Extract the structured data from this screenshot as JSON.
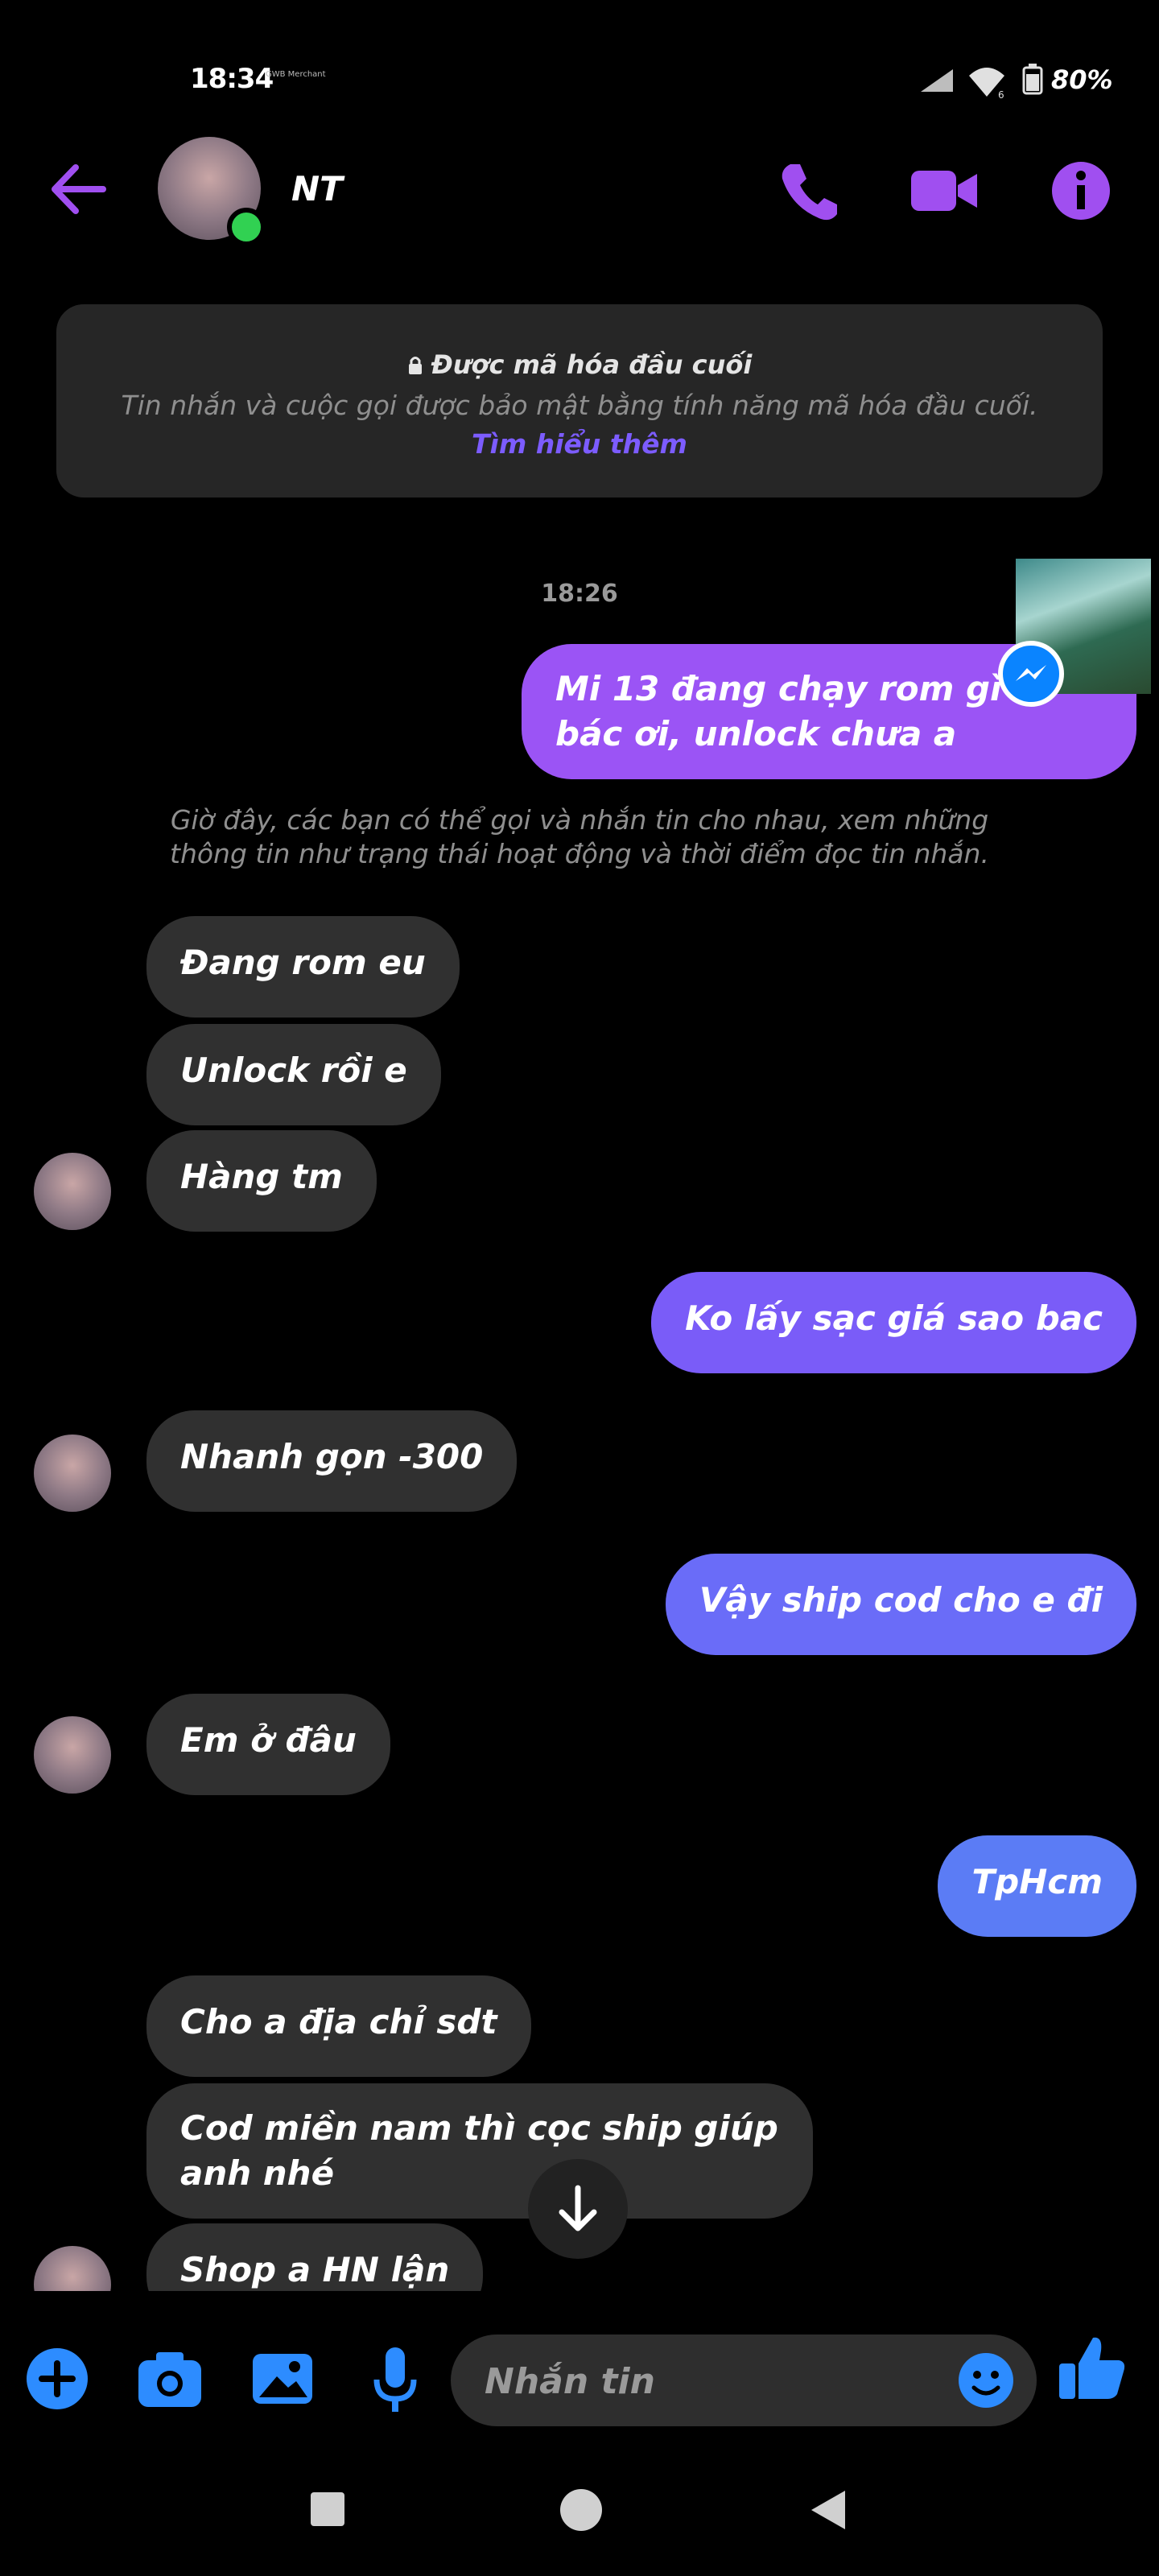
{
  "status_bar": {
    "time": "18:34",
    "small_text": "GWB\nMerchant",
    "battery": "80%"
  },
  "header": {
    "contact_name": "NT",
    "icons": [
      "back-arrow-icon",
      "phone-icon",
      "video-camera-icon",
      "info-icon"
    ]
  },
  "notice": {
    "title": "Được mã hóa đầu cuối",
    "body": "Tin nhắn và cuộc gọi được bảo mật bằng tính năng mã hóa đầu cuối.",
    "link": "Tìm hiểu thêm"
  },
  "timestamp": "18:26",
  "system_note": "Giờ đây, các bạn có thể gọi và nhắn tin cho nhau, xem những thông tin như trạng thái hoạt động và thời điểm đọc tin nhắn.",
  "messages": [
    {
      "sender": "me",
      "text": "Mi 13 đang chạy rom gì á bác ơi, unlock chưa a"
    },
    {
      "sender": "them",
      "text": "Đang rom eu"
    },
    {
      "sender": "them",
      "text": "Unlock rồi e"
    },
    {
      "sender": "them",
      "text": "Hàng tm"
    },
    {
      "sender": "me",
      "text": "Ko lấy sạc giá sao bac"
    },
    {
      "sender": "them",
      "text": "Nhanh gọn -300"
    },
    {
      "sender": "me",
      "text": "Vậy ship cod cho e đi"
    },
    {
      "sender": "them",
      "text": "Em ở đâu"
    },
    {
      "sender": "me",
      "text": "TpHcm"
    },
    {
      "sender": "them",
      "text": "Cho a địa chỉ sdt"
    },
    {
      "sender": "them",
      "text": "Cod miền nam thì cọc ship giúp anh nhé"
    },
    {
      "sender": "them",
      "text": "Shop a HN lận"
    }
  ],
  "composer": {
    "placeholder": "Nhắn tin"
  },
  "colors": {
    "accent_purple": "#a04ff0",
    "bubble_purple": "#9b54f5",
    "bubble_violet": "#7a5cf8",
    "bubble_blue": "#5b7cf5",
    "icon_blue": "#2d8cff",
    "online_green": "#31d152"
  }
}
